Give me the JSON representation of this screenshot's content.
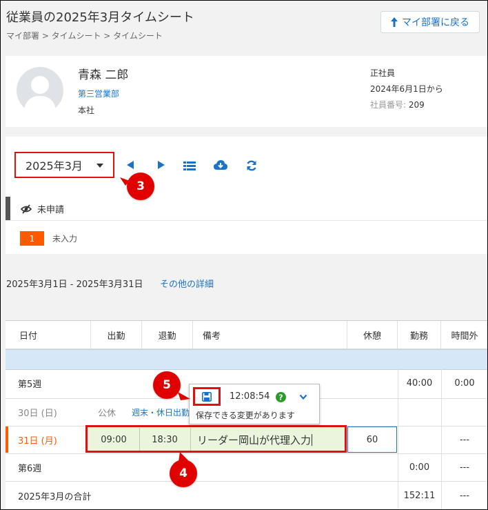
{
  "header": {
    "title": "従業員の2025年3月タイムシート",
    "breadcrumb": "マイ部署 > タイムシート > タイムシート",
    "back_button": "マイ部署に戻る"
  },
  "employee": {
    "name": "青森 二郎",
    "department": "第三営業部",
    "office": "本社",
    "type": "正社員",
    "since": "2024年6月1日から",
    "number_label": "社員番号:",
    "number": "209"
  },
  "controls": {
    "month": "2025年3月",
    "icons": [
      "prev-icon",
      "next-icon",
      "list-icon",
      "cloud-download-icon",
      "refresh-icon"
    ]
  },
  "status": {
    "label": "未申請",
    "badge_count": "1",
    "badge_label": "未入力"
  },
  "period": {
    "range": "2025年3月1日 - 2025年3月31日",
    "details_link": "その他の詳細"
  },
  "table": {
    "headers": [
      "日付",
      "出勤",
      "退勤",
      "備考",
      "休憩",
      "勤務",
      "時間外"
    ],
    "week5": {
      "label": "第5週",
      "work": "40:00",
      "overtime": "0:00"
    },
    "day30": {
      "date": "30日 (日)",
      "type": "公休",
      "note": "週末・休日出勤"
    },
    "day31": {
      "date": "31日 (月)",
      "in": "09:00",
      "out": "18:30",
      "note": "リーダー岡山が代理入力",
      "break": "60",
      "overtime": "---"
    },
    "week6": {
      "label": "第6週",
      "work": "0:00",
      "overtime": "---"
    },
    "total": {
      "label": "2025年3月の合計",
      "work": "152:11",
      "overtime": "---"
    }
  },
  "popup": {
    "time": "12:08:54",
    "message": "保存できる変更があります"
  },
  "callouts": [
    "3",
    "4",
    "5"
  ],
  "colors": {
    "accent": "#1a73c8",
    "highlight": "#e01010",
    "badge": "#ff5a00"
  }
}
